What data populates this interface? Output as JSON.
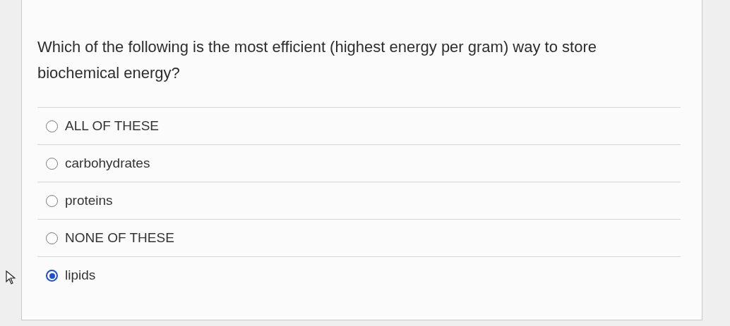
{
  "question": "Which of the following is the most efficient (highest energy per gram) way to store biochemical energy?",
  "options": [
    {
      "label": "ALL OF THESE",
      "selected": false
    },
    {
      "label": "carbohydrates",
      "selected": false
    },
    {
      "label": "proteins",
      "selected": false
    },
    {
      "label": "NONE OF THESE",
      "selected": false
    },
    {
      "label": "lipids",
      "selected": true
    }
  ]
}
